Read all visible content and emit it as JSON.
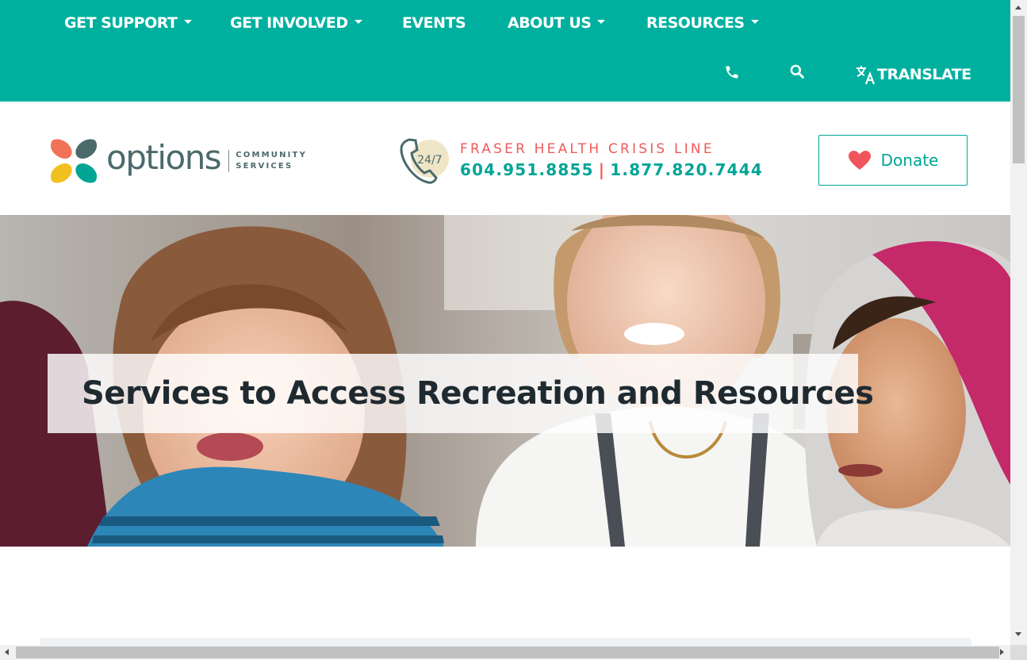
{
  "nav": {
    "items": [
      {
        "label": "GET SUPPORT",
        "dropdown": true
      },
      {
        "label": "GET INVOLVED",
        "dropdown": true
      },
      {
        "label": "EVENTS",
        "dropdown": false
      },
      {
        "label": "ABOUT US",
        "dropdown": true
      },
      {
        "label": "RESOURCES",
        "dropdown": true
      }
    ],
    "utility": {
      "phone_icon": "phone-icon",
      "search_icon": "search-icon",
      "translate_label": "TRANSLATE",
      "translate_icon": "translate-icon"
    }
  },
  "header": {
    "logo": {
      "word": "options",
      "sub_line1": "COMMUNITY",
      "sub_line2": "SERVICES"
    },
    "crisis": {
      "badge": "24/7",
      "title": "FRASER HEALTH CRISIS LINE",
      "phone1": "604.951.8855",
      "separator": "|",
      "phone2": "1.877.820.7444"
    },
    "donate": {
      "label": "Donate",
      "icon": "heart-icon"
    }
  },
  "hero": {
    "title": "Services to Access Recreation and Resources",
    "image": "photo of three smiling children"
  },
  "colors": {
    "brand_teal": "#00b09f",
    "teal_text": "#00a596",
    "crisis_red": "#ef5a5a",
    "logo_gray": "#4b6a6b",
    "dark_text": "#1f2a30"
  }
}
